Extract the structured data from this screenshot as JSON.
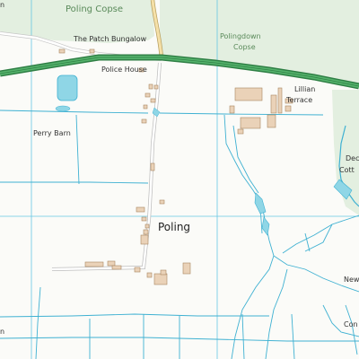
{
  "map": {
    "colors": {
      "background": "#fbfbf8",
      "woodland": "#e3efe0",
      "main_road": "#3f9a57",
      "minor_road": "#d0d0d0",
      "lane": "#f5e0a8",
      "water": "#8fd6e6",
      "water_line": "#3fb1d2",
      "grid": "#66c7e3",
      "building": "#ead2b8",
      "building_outline": "#a88560"
    },
    "labels": {
      "poling_copse": "Poling Copse",
      "patch_bungalow": "The Patch Bungalow",
      "police_house": "Police House",
      "polingdown": "Polingdown",
      "copse": "Copse",
      "lillian": "Lillian",
      "terrace": "Terrace",
      "perry_barn": "Perry Barn",
      "poling": "Poling",
      "dec": "Dec",
      "cott": "Cott",
      "new": "New",
      "con": "Con",
      "edge_n": "n",
      "edge_n2": "n"
    }
  }
}
